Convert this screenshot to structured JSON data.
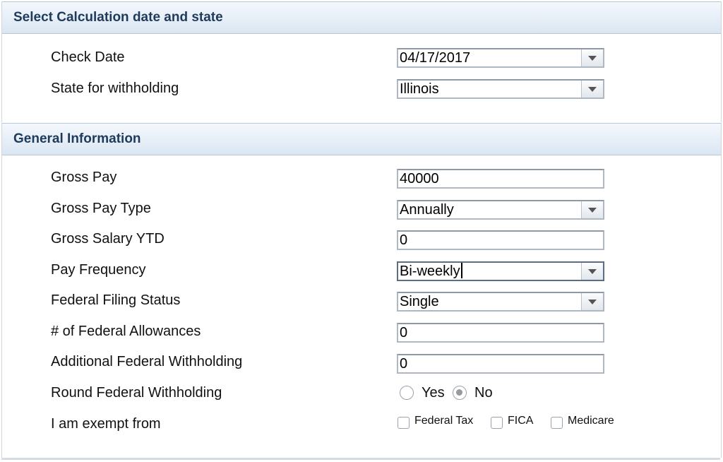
{
  "sections": [
    {
      "title": "Select Calculation date and state",
      "fields": [
        {
          "label": "Check Date",
          "value": "04/17/2017"
        },
        {
          "label": "State for withholding",
          "value": "Illinois"
        }
      ]
    },
    {
      "title": "General Information",
      "fields": [
        {
          "label": "Gross Pay",
          "value": "40000"
        },
        {
          "label": "Gross Pay Type",
          "value": "Annually"
        },
        {
          "label": "Gross Salary YTD",
          "value": "0"
        },
        {
          "label": "Pay Frequency",
          "value": "Bi-weekly"
        },
        {
          "label": "Federal Filing Status",
          "value": "Single"
        },
        {
          "label": "# of Federal Allowances",
          "value": "0"
        },
        {
          "label": "Additional Federal Withholding",
          "value": "0"
        },
        {
          "label": "Round Federal Withholding",
          "options": [
            "Yes",
            "No"
          ],
          "selected": "No"
        },
        {
          "label": "I am exempt from",
          "checkboxes": [
            "Federal Tax",
            "FICA",
            "Medicare"
          ]
        }
      ]
    }
  ]
}
